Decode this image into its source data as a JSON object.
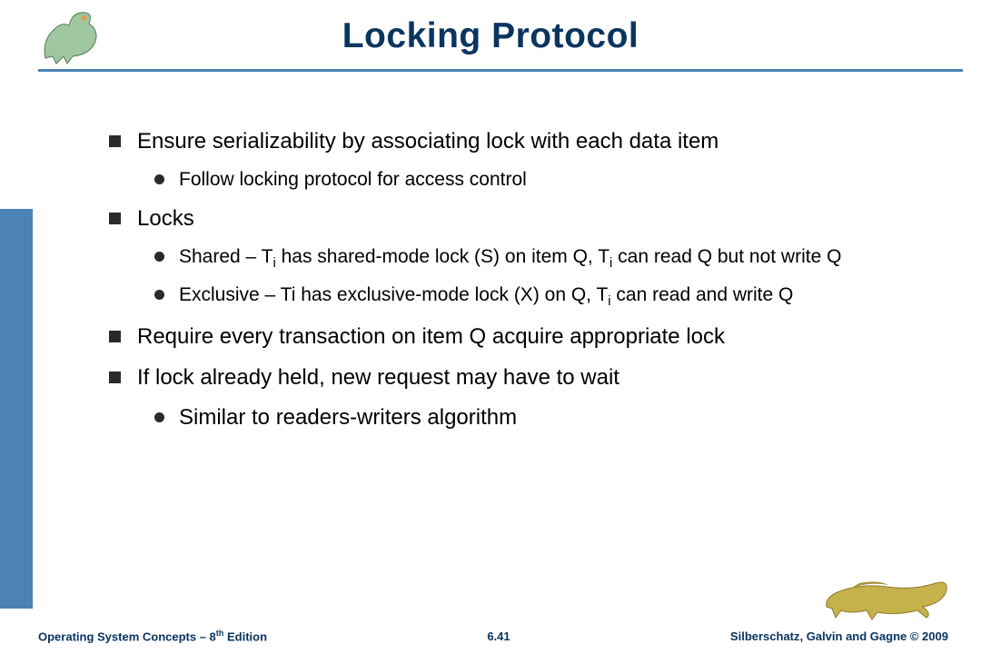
{
  "title": "Locking Protocol",
  "bullets": {
    "b1": "Ensure serializability by associating lock with each data item",
    "b1a": "Follow locking protocol for access control",
    "b2": "Locks",
    "b2a_prefix": "Shared – T",
    "b2a_mid1": " has shared-mode lock (S) on item Q, T",
    "b2a_suffix": " can read Q but not write Q",
    "b2b_prefix": "Exclusive – Ti has exclusive-mode lock (X) on Q, T",
    "b2b_suffix": " can read and write Q",
    "sub_i": "i",
    "b3": "Require every transaction on item Q acquire appropriate lock",
    "b4": "If lock already held, new request may have to wait",
    "b4a": "Similar to readers-writers algorithm"
  },
  "footer": {
    "left_prefix": "Operating System Concepts – 8",
    "left_sup": "th",
    "left_suffix": " Edition",
    "page": "6.41",
    "right": "Silberschatz, Galvin and Gagne © 2009"
  }
}
